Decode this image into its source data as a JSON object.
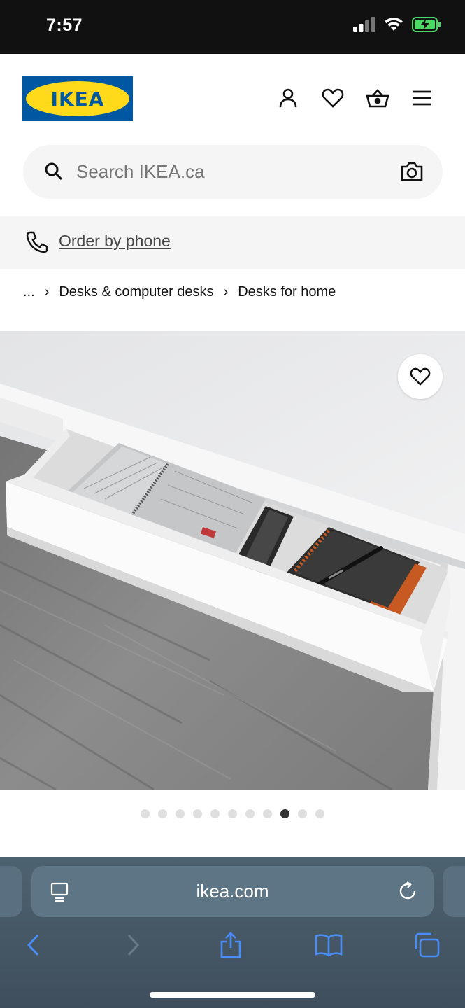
{
  "status_bar": {
    "time": "7:57"
  },
  "header": {
    "logo_text": "IKEA",
    "icons": [
      "account-icon",
      "heart-icon",
      "cart-icon",
      "menu-icon"
    ]
  },
  "search": {
    "placeholder": "Search IKEA.ca"
  },
  "phone": {
    "label": "Order by phone"
  },
  "breadcrumb": {
    "items": [
      "...",
      "Desks & computer desks",
      "Desks for home"
    ]
  },
  "gallery": {
    "total_images": 11,
    "active_index": 8
  },
  "browser": {
    "url": "ikea.com"
  },
  "colors": {
    "ikea_blue": "#0058a3",
    "ikea_yellow": "#ffda1a",
    "safari_accent": "#4a8df7"
  }
}
